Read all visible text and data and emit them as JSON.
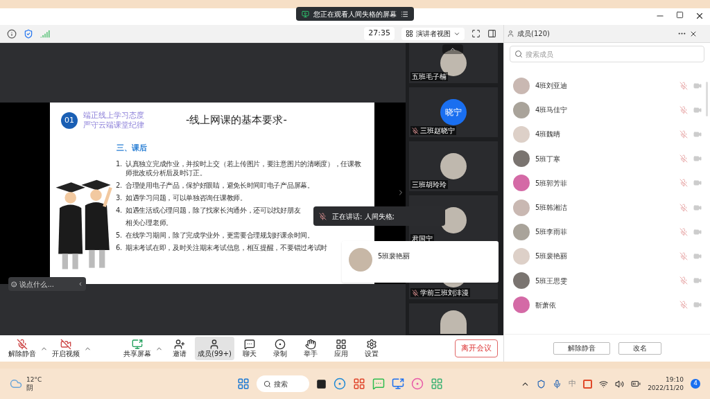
{
  "banner": {
    "text": "您正在观看人间失格的屏幕"
  },
  "toolbar": {
    "timer": "27:35",
    "view": "演讲者视图"
  },
  "slide": {
    "badge": "01",
    "heading": [
      "端正线上学习态度",
      "严守云端课堂纪律"
    ],
    "title": "-线上网课的基本要求-",
    "section": "三、课后",
    "items": [
      {
        "number": "1.",
        "lines": [
          "认真独立完成作业，并按时上交（若上传图片，要注意图片的清晰度），任课教师批改或分析后及时订正。"
        ]
      },
      {
        "number": "2.",
        "lines": [
          "合理使用电子产品，保护好眼睛，避免长时间盯电子产品屏幕。"
        ]
      },
      {
        "number": "3.",
        "lines": [
          "如遇学习问题，可以单独咨询任课教师。"
        ]
      },
      {
        "number": "4.",
        "lines": [
          "如遇生活或心理问题，除了找家长沟通外，还可以找好朋友",
          "相关心理老师。"
        ]
      },
      {
        "number": "5.",
        "lines": [
          "在线学习期间，除了完成学业外，更需要合理规划好课余时间。"
        ]
      },
      {
        "number": "6.",
        "lines": [
          "期末考试在即，及时关注期末考试信息，相互提醒，不要错过考试时"
        ]
      }
    ]
  },
  "chat_input": {
    "placeholder": "说点什么..."
  },
  "speaking": {
    "text": "正在讲话: 人间失格;"
  },
  "popup": {
    "name": "5班裴艳丽"
  },
  "tiles": [
    {
      "name": "五班毛子楠",
      "mic_muted": false
    },
    {
      "name": "三班赵晓宁",
      "mic_muted": true,
      "avatar_text": "晓宁"
    },
    {
      "name": "三班胡玲玲",
      "mic_muted": false
    },
    {
      "name": "君国宁",
      "mic_muted": false
    },
    {
      "name": "学前三班刘沣漫",
      "mic_muted": true
    }
  ],
  "controls": [
    {
      "label": "解除静音",
      "menu": true,
      "selected": false
    },
    {
      "label": "开启视频",
      "menu": true,
      "selected": false
    },
    {
      "label": "共享屏幕",
      "menu": true,
      "selected": false
    },
    {
      "label": "邀请",
      "menu": false,
      "selected": false
    },
    {
      "label": "成员(99+)",
      "menu": false,
      "selected": true
    },
    {
      "label": "聊天",
      "menu": false,
      "selected": false
    },
    {
      "label": "录制",
      "menu": false,
      "selected": false
    },
    {
      "label": "举手",
      "menu": false,
      "selected": false
    },
    {
      "label": "应用",
      "menu": false,
      "selected": false
    },
    {
      "label": "设置",
      "menu": false,
      "selected": false
    }
  ],
  "leave_button": "离开会议",
  "members_panel": {
    "title": "成员(120)",
    "search_placeholder": "搜索成员",
    "members": [
      {
        "name": "4班刘亚迪",
        "muted": true
      },
      {
        "name": "4班马佳宁",
        "muted": true
      },
      {
        "name": "4班魏晴",
        "muted": true
      },
      {
        "name": "5班丁寒",
        "muted": true
      },
      {
        "name": "5班郭芳菲",
        "muted": true
      },
      {
        "name": "5班韩湘洁",
        "muted": true
      },
      {
        "name": "5班李雨菲",
        "muted": true
      },
      {
        "name": "5班裴艳丽",
        "muted": true
      },
      {
        "name": "5班王思雯",
        "muted": true
      },
      {
        "name": "靳萧依",
        "muted": true
      }
    ],
    "buttons": [
      "解除静音",
      "改名"
    ]
  },
  "taskbar": {
    "temperature": "12°C",
    "weather": "阴",
    "search": "搜索",
    "ime": "中",
    "time": "19:10",
    "date": "2022/11/20",
    "notifications": "4"
  }
}
